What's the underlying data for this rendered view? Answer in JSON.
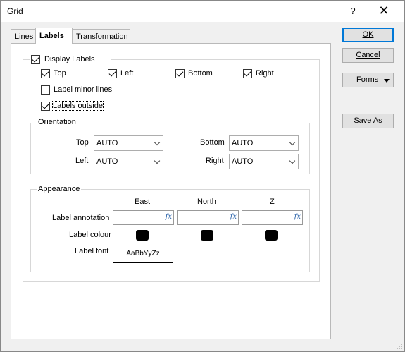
{
  "window": {
    "title": "Grid",
    "help": "?",
    "close": "✕"
  },
  "tabs": [
    {
      "label": "Lines"
    },
    {
      "label": "Labels"
    },
    {
      "label": "Transformation"
    }
  ],
  "labels_tab": {
    "display_labels": {
      "label": "Display Labels",
      "checked": true
    },
    "sides": [
      {
        "label": "Top",
        "checked": true
      },
      {
        "label": "Left",
        "checked": true
      },
      {
        "label": "Bottom",
        "checked": true
      },
      {
        "label": "Right",
        "checked": true
      }
    ],
    "label_minor_lines": {
      "label": "Label minor lines",
      "checked": false
    },
    "labels_outside": {
      "label": "Labels outside",
      "checked": true
    },
    "orientation": {
      "title": "Orientation",
      "top": {
        "label": "Top",
        "value": "AUTO"
      },
      "left": {
        "label": "Left",
        "value": "AUTO"
      },
      "bottom": {
        "label": "Bottom",
        "value": "AUTO"
      },
      "right": {
        "label": "Right",
        "value": "AUTO"
      }
    },
    "appearance": {
      "title": "Appearance",
      "columns": [
        "East",
        "North",
        "Z"
      ],
      "label_annotation": "Label annotation",
      "label_colour": "Label colour",
      "label_font": "Label font",
      "font_preview": "AaBbYyZz",
      "fx": "fx",
      "colour": "#000000"
    }
  },
  "buttons": {
    "ok": "OK",
    "cancel": "Cancel",
    "forms": "Forms",
    "save_as": "Save As"
  }
}
